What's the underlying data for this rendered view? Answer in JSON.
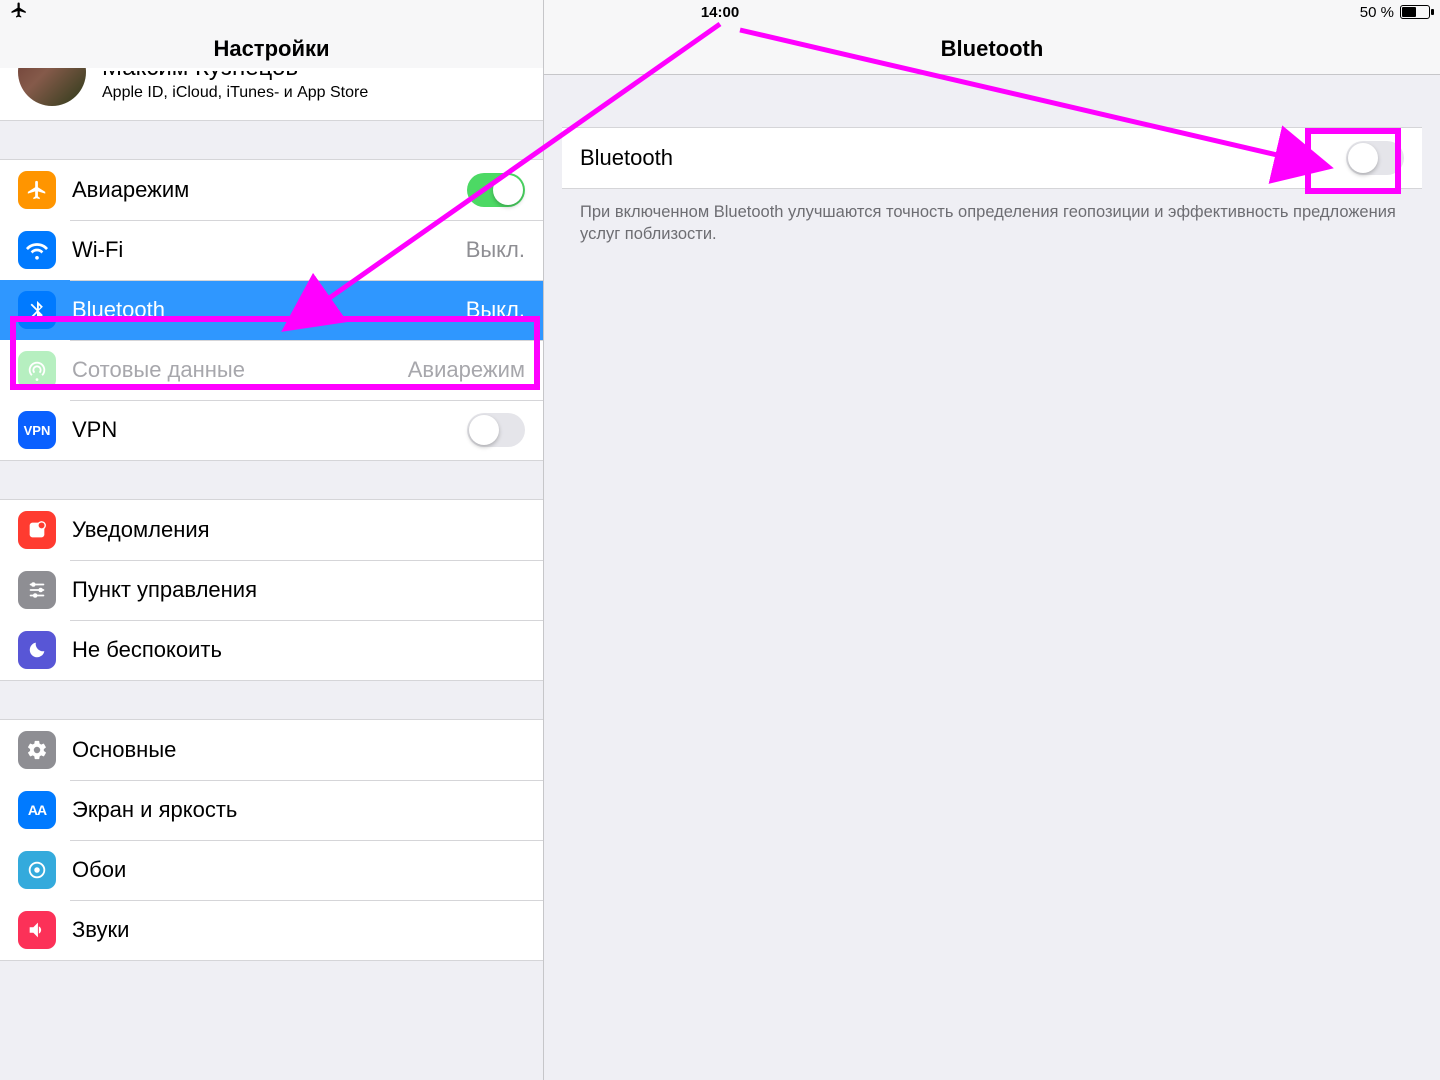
{
  "status": {
    "time": "14:00",
    "battery_label": "50 %",
    "battery_fill_pct": 50,
    "airplane_icon": "airplane-icon"
  },
  "annotation": {
    "color": "#ff00ff"
  },
  "left": {
    "title": "Настройки",
    "profile": {
      "name": "Максим Кузнецов",
      "sub": "Apple ID, iCloud, iTunes- и App Store"
    },
    "group_network": [
      {
        "id": "airplane",
        "icon": "airplane-icon",
        "color": "ic-orange",
        "label": "Авиарежим",
        "value": "",
        "toggle": true,
        "toggle_on": true,
        "selected": false,
        "disabled": false
      },
      {
        "id": "wifi",
        "icon": "wifi-icon",
        "color": "ic-blue",
        "label": "Wi-Fi",
        "value": "Выкл.",
        "toggle": false,
        "toggle_on": false,
        "selected": false,
        "disabled": false
      },
      {
        "id": "bluetooth",
        "icon": "bluetooth-icon",
        "color": "ic-blue",
        "label": "Bluetooth",
        "value": "Выкл.",
        "toggle": false,
        "toggle_on": false,
        "selected": true,
        "disabled": false
      },
      {
        "id": "cellular",
        "icon": "cellular-icon",
        "color": "ic-green",
        "label": "Сотовые данные",
        "value": "Авиарежим",
        "toggle": false,
        "toggle_on": false,
        "selected": false,
        "disabled": true
      },
      {
        "id": "vpn",
        "icon": "vpn-icon",
        "color": "ic-sysblue",
        "label": "VPN",
        "value": "",
        "toggle": true,
        "toggle_on": false,
        "selected": false,
        "disabled": false
      }
    ],
    "group_notifications": [
      {
        "id": "notifications",
        "icon": "notifications-icon",
        "color": "ic-red",
        "label": "Уведомления"
      },
      {
        "id": "controlcenter",
        "icon": "controlcenter-icon",
        "color": "ic-gray",
        "label": "Пункт управления"
      },
      {
        "id": "dnd",
        "icon": "dnd-icon",
        "color": "ic-purple",
        "label": "Не беспокоить"
      }
    ],
    "group_general": [
      {
        "id": "general",
        "icon": "gear-icon",
        "color": "ic-gray",
        "label": "Основные"
      },
      {
        "id": "display",
        "icon": "display-icon",
        "color": "ic-blue",
        "label": "Экран и яркость"
      },
      {
        "id": "wallpaper",
        "icon": "wallpaper-icon",
        "color": "ic-cyan",
        "label": "Обои"
      },
      {
        "id": "sounds",
        "icon": "sounds-icon",
        "color": "ic-pink",
        "label": "Звуки"
      }
    ]
  },
  "detail": {
    "title": "Bluetooth",
    "switch_label": "Bluetooth",
    "switch_on": false,
    "footer": "При включенном Bluetooth улучшаются точность определения геопозиции и эффективность предложения услуг поблизости."
  }
}
